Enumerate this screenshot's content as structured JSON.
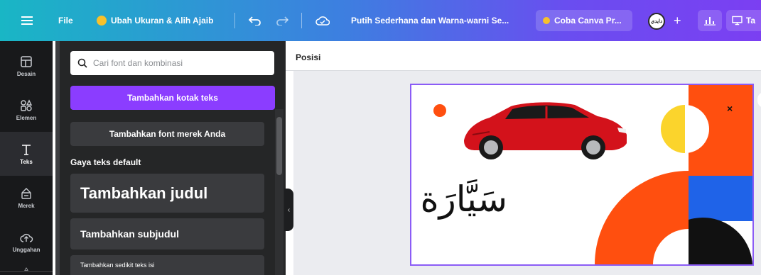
{
  "topbar": {
    "menu_icon": "hamburger-icon",
    "file_label": "File",
    "resize_label": "Ubah Ukuran & Alih Ajaib",
    "design_title": "Putih Sederhana dan Warna-warni Se...",
    "try_pro_label": "Coba Canva Pr...",
    "avatar_text": "دايدي",
    "present_label": "Ta"
  },
  "rail": {
    "items": [
      {
        "label": "Desain",
        "icon": "layout-icon"
      },
      {
        "label": "Elemen",
        "icon": "shapes-icon"
      },
      {
        "label": "Teks",
        "icon": "text-icon"
      },
      {
        "label": "Merek",
        "icon": "brand-icon"
      },
      {
        "label": "Unggahan",
        "icon": "upload-cloud-icon"
      }
    ],
    "active": "Teks"
  },
  "panel": {
    "search_placeholder": "Cari font dan kombinasi",
    "add_textbox_label": "Tambahkan kotak teks",
    "add_brand_font_label": "Tambahkan font merek Anda",
    "default_styles_title": "Gaya teks default",
    "heading_label": "Tambahkan judul",
    "subheading_label": "Tambahkan subjudul",
    "body_label": "Tambahkan sedikit teks isi"
  },
  "workspace": {
    "position_label": "Posisi"
  },
  "canvas": {
    "arabic_word": "سَيَّارَة",
    "close_symbol": "×"
  },
  "colors": {
    "accent_purple": "#8b3dff",
    "orange": "#ff4f0f",
    "yellow": "#fbd42c",
    "blue": "#1f63e8",
    "car_red": "#d3121b"
  }
}
